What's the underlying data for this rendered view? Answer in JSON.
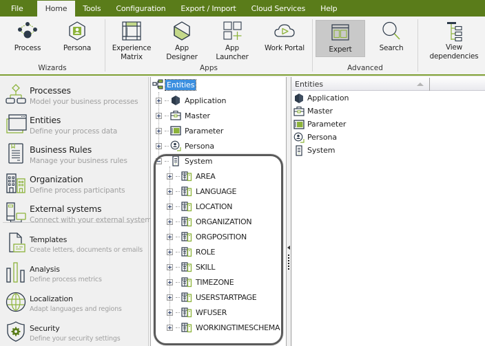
{
  "menubar": {
    "items": [
      "File",
      "Home",
      "Tools",
      "Configuration",
      "Export / Import",
      "Cloud Services",
      "Help"
    ],
    "active": "Home"
  },
  "ribbon": {
    "groups": [
      {
        "label": "Wizards",
        "buttons": [
          {
            "label": "Process",
            "icon": "process-icon"
          },
          {
            "label": "Persona",
            "icon": "persona-icon"
          }
        ]
      },
      {
        "label": "Apps",
        "buttons": [
          {
            "label": "Experience Matrix",
            "line1": "Experience",
            "line2": "Matrix",
            "icon": "experience-matrix-icon"
          },
          {
            "label": "App Designer",
            "icon": "app-designer-icon"
          },
          {
            "label": "App Launcher",
            "icon": "app-launcher-icon"
          },
          {
            "label": "Work Portal",
            "icon": "work-portal-icon"
          }
        ]
      },
      {
        "label": "Advanced",
        "buttons": [
          {
            "label": "Expert",
            "icon": "expert-icon",
            "selected": true
          },
          {
            "label": "Search",
            "icon": "search-icon"
          }
        ]
      },
      {
        "label": "",
        "buttons": [
          {
            "label": "View dependencies",
            "icon": "view-dependencies-icon"
          }
        ]
      }
    ]
  },
  "leftnav": {
    "items": [
      {
        "title": "Processes",
        "subtitle": "Model your business processes"
      },
      {
        "title": "Entities",
        "subtitle": "Define your process data"
      },
      {
        "title": "Business Rules",
        "subtitle": "Manage your business rules"
      },
      {
        "title": "Organization",
        "subtitle": "Define process participants"
      },
      {
        "title": "External systems",
        "subtitle": "Connect with your external systems"
      },
      {
        "title": "Templates",
        "subtitle": "Create letters, documents  or emails"
      },
      {
        "title": "Analysis",
        "subtitle": "Define process metrics"
      },
      {
        "title": "Localization",
        "subtitle": "Adapt languages and regions"
      },
      {
        "title": "Security",
        "subtitle": "Define your security settings"
      }
    ]
  },
  "tree": {
    "root": "Entities",
    "nodes": [
      {
        "label": "Application",
        "expanded": false
      },
      {
        "label": "Master",
        "expanded": false
      },
      {
        "label": "Parameter",
        "expanded": false
      },
      {
        "label": "Persona",
        "expanded": false
      },
      {
        "label": "System",
        "expanded": true
      }
    ],
    "system_children": [
      "AREA",
      "LANGUAGE",
      "LOCATION",
      "ORGANIZATION",
      "ORGPOSITION",
      "ROLE",
      "SKILL",
      "TIMEZONE",
      "USERSTARTPAGE",
      "WFUSER",
      "WORKINGTIMESCHEMA"
    ]
  },
  "list": {
    "column_header": "Entities",
    "rows": [
      "Application",
      "Master",
      "Parameter",
      "Persona",
      "System"
    ]
  },
  "colors": {
    "menubar": "#5a7c1a",
    "accent_green": "#8cb33a",
    "icon_navy": "#2d3a4a",
    "selection_blue": "#3b8fe0"
  }
}
